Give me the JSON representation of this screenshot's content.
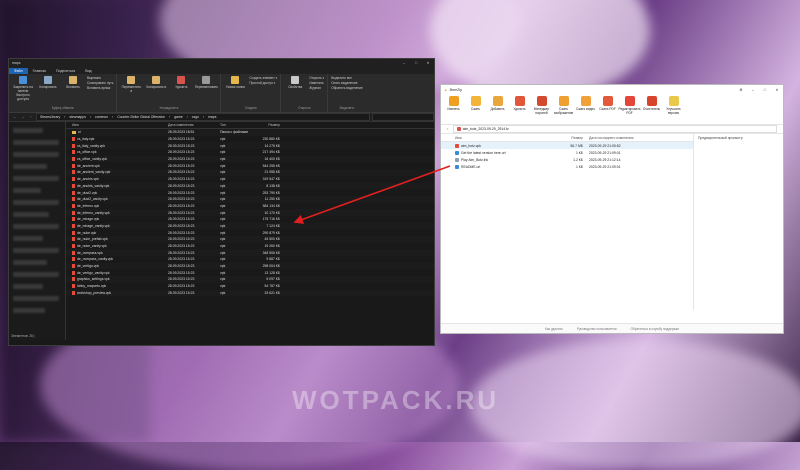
{
  "watermark": "WOTPACK.RU",
  "explorer": {
    "title": "maps",
    "tabs": [
      "Файл",
      "Главная",
      "Поделиться",
      "Вид"
    ],
    "ribbon": {
      "pin": "Закрепить на панели быстрого доступа",
      "copy": "Копировать",
      "paste": "Вставить",
      "cut": "Вырезать",
      "copy_path": "Скопировать путь",
      "paste_shortcut": "Вставить ярлык",
      "clipboard": "Буфер обмена",
      "move_to": "Переместить в",
      "copy_to": "Копировать в",
      "delete": "Удалить",
      "rename": "Переименовать",
      "organize": "Упорядочить",
      "new_folder": "Новая папка",
      "new_item": "Создать элемент ▾",
      "easy_access": "Простой доступ ▾",
      "create": "Создать",
      "properties": "Свойства",
      "open": "Открыть ▾",
      "edit": "Изменить",
      "journal": "Журнал",
      "open_group": "Открыть",
      "select_all": "Выделить все",
      "select_none": "Снять выделение",
      "invert": "Обратить выделение",
      "select_group": "Выделить"
    },
    "path": [
      "SteamLibrary",
      "steamapps",
      "common",
      "Counter-Strike Global Offensive",
      "game",
      "csgo",
      "maps"
    ],
    "columns": [
      "Имя",
      "Дата изменения",
      "Тип",
      "Размер"
    ],
    "files": [
      {
        "name": "ui",
        "date": "28.09.2023 18:51",
        "type": "Папка с файлами",
        "size": ""
      },
      {
        "name": "cs_italy.vpk",
        "date": "28.09.2023 15:23",
        "type": "vpk",
        "size": "230 880 КБ"
      },
      {
        "name": "cs_italy_vanity.vpk",
        "date": "28.09.2023 15:23",
        "type": "vpk",
        "size": "14 275 КБ"
      },
      {
        "name": "cs_office.vpk",
        "date": "28.09.2023 15:23",
        "type": "vpk",
        "size": "217 494 КБ"
      },
      {
        "name": "cs_office_vanity.vpk",
        "date": "28.09.2023 15:23",
        "type": "vpk",
        "size": "16 400 КБ"
      },
      {
        "name": "de_ancient.vpk",
        "date": "28.09.2023 15:23",
        "type": "vpk",
        "size": "544 255 КБ"
      },
      {
        "name": "de_ancient_vanity.vpk",
        "date": "28.09.2023 15:23",
        "type": "vpk",
        "size": "21 955 КБ"
      },
      {
        "name": "de_anubis.vpk",
        "date": "28.09.2023 15:23",
        "type": "vpk",
        "size": "319 547 КБ"
      },
      {
        "name": "de_anubis_vanity.vpk",
        "date": "28.09.2023 15:23",
        "type": "vpk",
        "size": "8 138 КБ"
      },
      {
        "name": "de_dust2.vpk",
        "date": "28.09.2023 15:23",
        "type": "vpk",
        "size": "253 790 КБ"
      },
      {
        "name": "de_dust2_vanity.vpk",
        "date": "28.09.2023 15:23",
        "type": "vpk",
        "size": "11 250 КБ"
      },
      {
        "name": "de_inferno.vpk",
        "date": "28.09.2023 15:23",
        "type": "vpk",
        "size": "584 134 КБ"
      },
      {
        "name": "de_inferno_vanity.vpk",
        "date": "28.09.2023 15:23",
        "type": "vpk",
        "size": "10 170 КБ"
      },
      {
        "name": "de_mirage.vpk",
        "date": "28.09.2023 15:23",
        "type": "vpk",
        "size": "175 716 КБ"
      },
      {
        "name": "de_mirage_vanity.vpk",
        "date": "28.09.2023 15:23",
        "type": "vpk",
        "size": "7 124 КБ"
      },
      {
        "name": "de_nuke.vpk",
        "date": "28.09.2023 15:23",
        "type": "vpk",
        "size": "290 879 КБ"
      },
      {
        "name": "de_nuke_prefab.vpk",
        "date": "28.09.2023 15:23",
        "type": "vpk",
        "size": "45 500 КБ"
      },
      {
        "name": "de_nuke_vanity.vpk",
        "date": "28.09.2023 15:23",
        "type": "vpk",
        "size": "19 260 КБ"
      },
      {
        "name": "de_overpass.vpk",
        "date": "28.09.2023 15:23",
        "type": "vpk",
        "size": "348 506 КБ"
      },
      {
        "name": "de_overpass_vanity.vpk",
        "date": "28.09.2023 15:23",
        "type": "vpk",
        "size": "9 887 КБ"
      },
      {
        "name": "de_vertigo.vpk",
        "date": "28.09.2023 15:23",
        "type": "vpk",
        "size": "298 004 КБ"
      },
      {
        "name": "de_vertigo_vanity.vpk",
        "date": "28.09.2023 15:23",
        "type": "vpk",
        "size": "13 128 КБ"
      },
      {
        "name": "graphics_settings.vpk",
        "date": "28.09.2023 15:23",
        "type": "vpk",
        "size": "5 097 КБ"
      },
      {
        "name": "lobby_mapveto.vpk",
        "date": "28.09.2023 15:23",
        "type": "vpk",
        "size": "54 787 КБ"
      },
      {
        "name": "workshop_preview.vpk",
        "date": "28.09.2023 15:23",
        "type": "vpk",
        "size": "33 621 КБ"
      }
    ],
    "status": "Элементов: 28  |"
  },
  "archive": {
    "title": "BreeZip",
    "toolbar": [
      "Извлечь",
      "Сжать",
      "Добавить",
      "Удалить",
      "Менеджер паролей",
      "Сжать изображение",
      "Сжать видео",
      "Сжать PDF",
      "Редактировать PDF",
      "Очиститель",
      "Улучшить версию"
    ],
    "tool_colors": [
      "#f0a020",
      "#f3b43a",
      "#e9a63a",
      "#e2563a",
      "#d44a2f",
      "#f0a030",
      "#f2a13a",
      "#e35a3a",
      "#e4463a",
      "#d8432c",
      "#e9c84a"
    ],
    "path": "aim_botz_2023-09-29_2514.fz",
    "columns": [
      "Имя",
      "Размер",
      "Дата последнего изменения"
    ],
    "preview_label": "Предварительный просмотр",
    "files": [
      {
        "name": "aim_botz.vpk",
        "size": "56.7 МБ",
        "date": "2023-09-29 21:05:52",
        "color": "#e84a3a"
      },
      {
        "name": "Get the latest version here.url",
        "size": "1 КБ",
        "date": "2023-09-29 21:09:01",
        "color": "#3a8ad8"
      },
      {
        "name": "Play Aim_Botz.lnk",
        "size": "1.2 КБ",
        "date": "2023-09-29 21:12:14",
        "color": "#8aa0b0"
      },
      {
        "name": "README.url",
        "size": "1 КБ",
        "date": "2023-09-29 21:09:01",
        "color": "#3a8ad8"
      }
    ],
    "footer": [
      "Как удалить",
      "Руководство пользователя",
      "Обратиться в службу поддержки"
    ]
  }
}
